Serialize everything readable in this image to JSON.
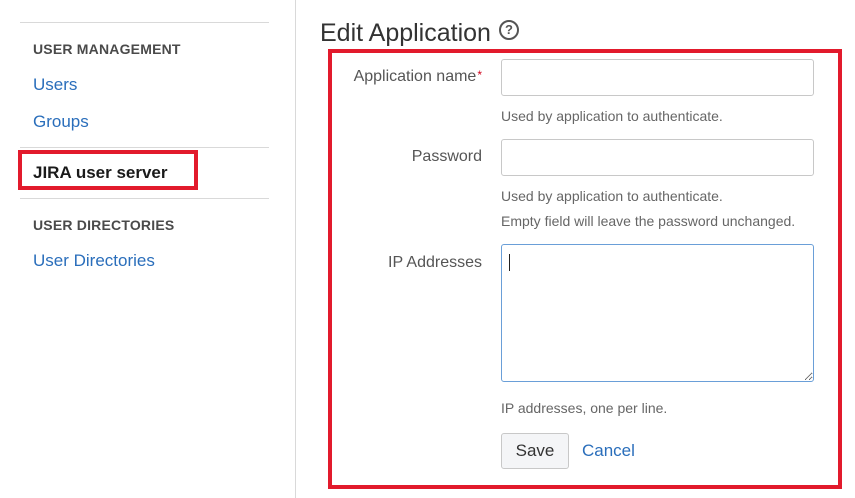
{
  "sidebar": {
    "user_management_heading": "USER MANAGEMENT",
    "users_link": "Users",
    "groups_link": "Groups",
    "active_item": "JIRA user server",
    "user_directories_heading": "USER DIRECTORIES",
    "user_directories_link": "User Directories"
  },
  "main": {
    "title": "Edit Application",
    "help_icon_glyph": "?",
    "form": {
      "application_name": {
        "label": "Application name",
        "required_marker": "*",
        "value": "",
        "help": "Used by application to authenticate."
      },
      "password": {
        "label": "Password",
        "value": "",
        "help_line1": "Used by application to authenticate.",
        "help_line2": "Empty field will leave the password unchanged."
      },
      "ip_addresses": {
        "label": "IP Addresses",
        "value": "",
        "help": "IP addresses, one per line."
      },
      "save_label": "Save",
      "cancel_label": "Cancel"
    }
  },
  "colors": {
    "highlight": "#e21a2c",
    "link": "#2a6ebb"
  }
}
